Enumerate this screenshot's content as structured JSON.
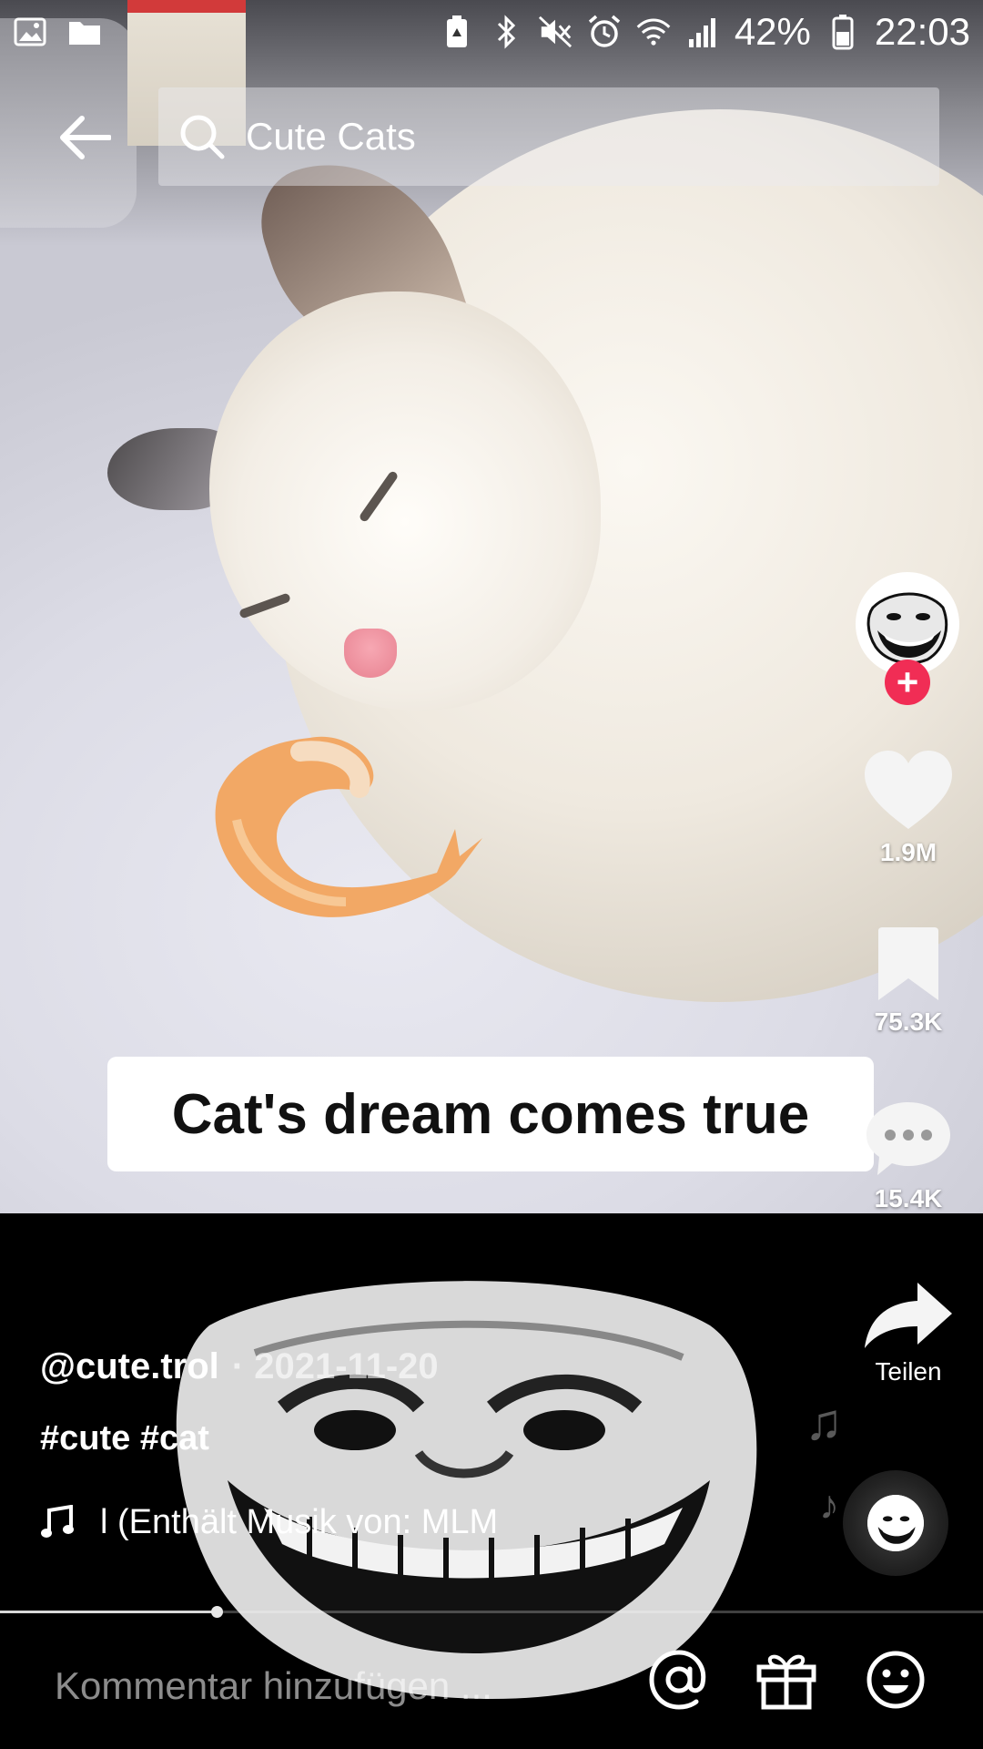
{
  "status_bar": {
    "battery_percent": "42%",
    "time": "22:03",
    "icons_left": [
      "gallery-icon",
      "folder-icon"
    ],
    "icons_right": [
      "battery-saver-icon",
      "bluetooth-icon",
      "mute-icon",
      "alarm-icon",
      "wifi-icon",
      "signal-icon",
      "battery-icon"
    ]
  },
  "header": {
    "search_query": "Cute Cats"
  },
  "video": {
    "caption_sticker": "Cat's dream comes true"
  },
  "post": {
    "author": "@cute.trol",
    "date": "· 2021-11-20",
    "hashtags": "#cute #cat",
    "music": "l (Enthält Musik von: MLM"
  },
  "actions": {
    "likes": "1.9M",
    "bookmarks": "75.3K",
    "comments": "15.4K",
    "share_label": "Teilen"
  },
  "playback": {
    "progress_fraction": 0.22
  },
  "comment_bar": {
    "placeholder": "Kommentar hinzufügen ..."
  },
  "colors": {
    "follow_accent": "#f12d55",
    "background": "#000000"
  }
}
